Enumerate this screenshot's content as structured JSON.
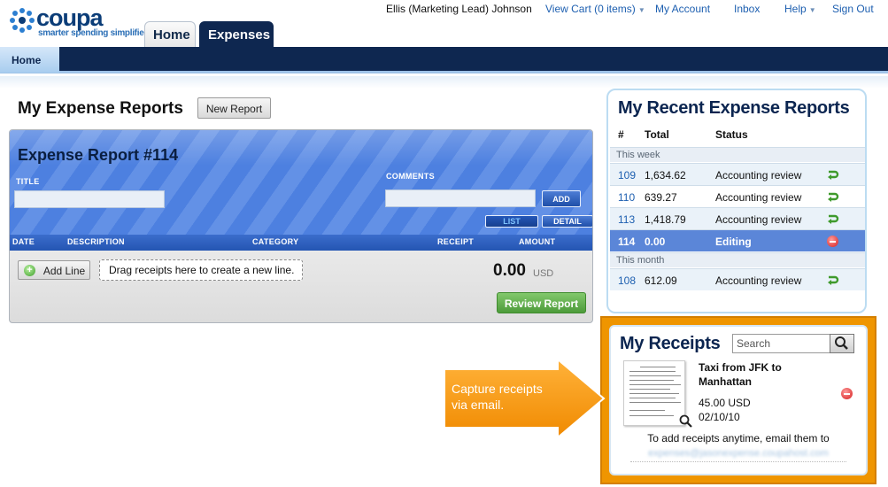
{
  "brand": {
    "name": "coupa",
    "tagline": "smarter spending simplified"
  },
  "main_tabs": [
    {
      "label": "Home"
    },
    {
      "label": "Expenses"
    }
  ],
  "topnav": {
    "user": "Ellis (Marketing Lead) Johnson",
    "cart": "View Cart (0 items)",
    "account": "My Account",
    "inbox": "Inbox",
    "help": "Help",
    "signout": "Sign Out"
  },
  "subnav": {
    "home": "Home"
  },
  "page": {
    "title": "My Expense Reports",
    "new_report": "New Report"
  },
  "report": {
    "title": "Expense Report #114",
    "title_label": "TITLE",
    "title_value": "",
    "comments_label": "COMMENTS",
    "comments_value": "",
    "add_button": "ADD",
    "list_button": "LIST",
    "detail_button": "DETAIL",
    "columns": [
      "DATE",
      "DESCRIPTION",
      "CATEGORY",
      "RECEIPT",
      "AMOUNT"
    ],
    "add_line": "Add Line",
    "drop_hint": "Drag receipts here to create a new line.",
    "total": "0.00",
    "currency": "USD",
    "review_button": "Review Report"
  },
  "recent": {
    "title": "My Recent Expense Reports",
    "columns": [
      "#",
      "Total",
      "Status"
    ],
    "groups": {
      "this_week": "This week",
      "this_month": "This month"
    },
    "rows": [
      {
        "num": "109",
        "total": "1,634.62",
        "status": "Accounting review",
        "icon": "reopen-icon"
      },
      {
        "num": "110",
        "total": "639.27",
        "status": "Accounting review",
        "icon": "reopen-icon"
      },
      {
        "num": "113",
        "total": "1,418.79",
        "status": "Accounting review",
        "icon": "reopen-icon"
      },
      {
        "num": "114",
        "total": "0.00",
        "status": "Editing",
        "icon": "remove-icon"
      },
      {
        "num": "108",
        "total": "612.09",
        "status": "Accounting review",
        "icon": "reopen-icon"
      }
    ]
  },
  "receipts": {
    "title": "My Receipts",
    "search_placeholder": "Search",
    "item": {
      "title": "Taxi from JFK to Manhattan",
      "amount": "45.00 USD",
      "date": "02/10/10"
    },
    "email_note": "To add receipts anytime, email them to",
    "email_address": "expenses@jasonexpense.coupahost.com"
  },
  "callout": {
    "text": "Capture receipts via email."
  },
  "colors": {
    "navy": "#0e2750",
    "link": "#1d5fb0",
    "report_blue": "#4d80e0",
    "selected_row": "#5b86d8",
    "review_green": "#4c9b3a",
    "callout_orange": "#ef9500"
  }
}
